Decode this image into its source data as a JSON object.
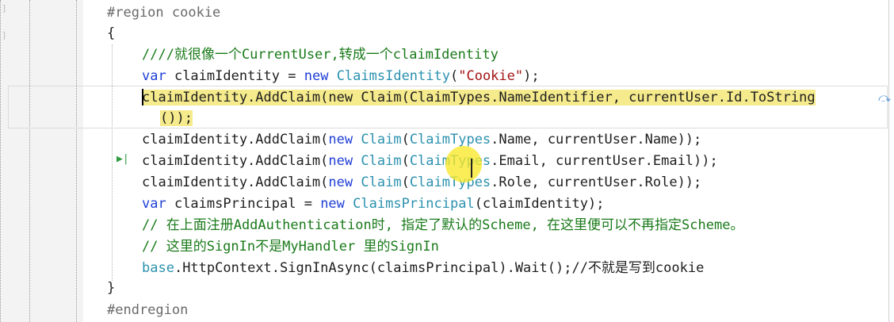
{
  "code": {
    "region_start": "#region cookie",
    "open_brace": "{",
    "comment1": "////就很像一个CurrentUser,转成一个claimIdentity",
    "line_identity": {
      "kw": "var",
      "name": " claimIdentity = ",
      "kw_new": "new",
      "type": "ClaimsIdentity",
      "paren_open": "(",
      "str": "\"Cookie\"",
      "tail": ");"
    },
    "line_nameid": {
      "start": "claimIdentity.AddClaim(",
      "kw_new": "new",
      "type": "Claim",
      "mid": "(",
      "type2": "ClaimTypes",
      "tail": ".NameIdentifier, currentUser.Id.ToString",
      "wrap": "());"
    },
    "line_name": {
      "start": "claimIdentity.AddClaim(",
      "kw_new": "new",
      "type": "Claim",
      "mid": "(",
      "type2": "ClaimTypes",
      "tail": ".Name, currentUser.Name));"
    },
    "line_email": {
      "start": "claimIdentity.AddClaim(",
      "kw_new": "new",
      "type": "Claim",
      "mid": "(",
      "type2": "ClaimTypes",
      "tail": ".Email, currentUser.Email));"
    },
    "line_role": {
      "start": "claimIdentity.AddClaim(",
      "kw_new": "new",
      "type": "Claim",
      "mid": "(",
      "type2": "ClaimTypes",
      "tail": ".Role, currentUser.Role));"
    },
    "line_principal": {
      "kw": "var",
      "name": " claimsPrincipal = ",
      "kw_new": "new",
      "type": "ClaimsPrincipal",
      "tail": "(claimIdentity);"
    },
    "comment2": "// 在上面注册AddAuthentication时, 指定了默认的Scheme, 在这里便可以不再指定Scheme。",
    "comment3": "// 这里的SignIn不是MyHandler 里的SignIn",
    "line_signin": {
      "kw": "base",
      "tail": ".HttpContext.SignInAsync(claimsPrincipal).Wait();//不就是写到cookie"
    },
    "close_brace": "}",
    "region_end": "#endregion"
  },
  "icons": {
    "wrap": "word-wrap-icon",
    "exec": "execution-pointer-icon"
  }
}
